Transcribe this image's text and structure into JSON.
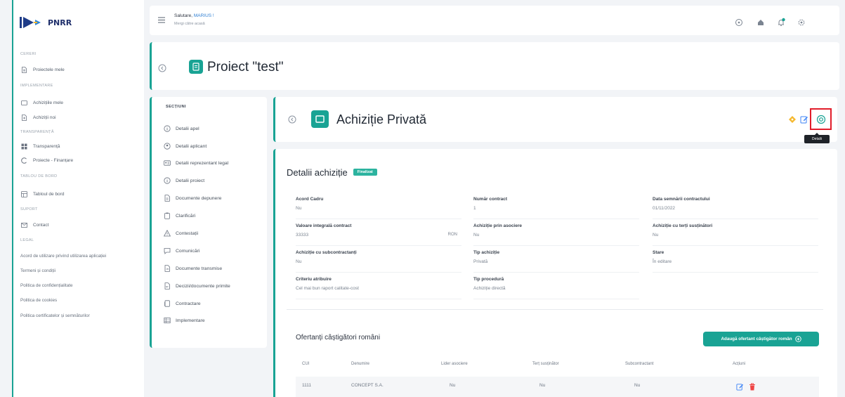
{
  "colors": {
    "accent": "#19a394",
    "badge": "#2cb39f",
    "highlight": "#e11d2a",
    "edit": "#3b82f6",
    "delete": "#ef4444",
    "pending": "#f5b82e"
  },
  "app": {
    "logo_text": "PNRR",
    "logo_icon": "pnrr-arrows-logo"
  },
  "topbar": {
    "menu_icon": "hamburger-icon",
    "greeting_prefix": "Salutare,",
    "user_name": "MARIUS !",
    "subtitle": "Mergi către acasă",
    "icons": [
      "help-icon",
      "home-icon",
      "notification-bell-icon",
      "settings-icon"
    ]
  },
  "sidebar": {
    "groups": [
      {
        "header": "CERERI",
        "items": [
          {
            "label": "Proiectele mele",
            "icon": "document-icon"
          }
        ]
      },
      {
        "header": "IMPLEMENTARE",
        "items": [
          {
            "label": "Achizițiile mele",
            "icon": "box-icon"
          },
          {
            "label": "Achiziții noi",
            "icon": "document-plus-icon"
          }
        ]
      },
      {
        "header": "TRANSPARENȚĂ",
        "items": [
          {
            "label": "Transparență",
            "icon": "grid-icon"
          },
          {
            "label": "Proiecte - Finanțare",
            "icon": "pie-chart-icon"
          }
        ]
      },
      {
        "header": "TABLOU DE BORD",
        "items": [
          {
            "label": "Tabloul de bord",
            "icon": "dashboard-icon"
          }
        ]
      },
      {
        "header": "SUPORT",
        "items": [
          {
            "label": "Contact",
            "icon": "mail-icon"
          }
        ]
      },
      {
        "header": "LEGAL",
        "links": [
          "Acord de utilizare privind utilizarea aplicației",
          "Termeni și condiții",
          "Politica de confidențialitate",
          "Politica de cookies",
          "Politica certificatelor și semnăturilor"
        ]
      }
    ]
  },
  "project": {
    "title": "Proiect \"test\"",
    "icon": "document-icon"
  },
  "sections_nav": {
    "header": "SECȚIUNI",
    "items": [
      {
        "label": "Detalii apel",
        "icon": "info-circle-icon"
      },
      {
        "label": "Detalii aplicant",
        "icon": "user-circle-icon"
      },
      {
        "label": "Detalii reprezentant legal",
        "icon": "id-card-icon"
      },
      {
        "label": "Detalii proiect",
        "icon": "info-circle-icon"
      },
      {
        "label": "Documente depunere",
        "icon": "document-icon"
      },
      {
        "label": "Clarificări",
        "icon": "clipboard-icon"
      },
      {
        "label": "Contestații",
        "icon": "warning-icon"
      },
      {
        "label": "Comunicări",
        "icon": "chat-icon"
      },
      {
        "label": "Documente transmise",
        "icon": "document-send-icon"
      },
      {
        "label": "Decizii/documente primite",
        "icon": "document-inbox-icon"
      },
      {
        "label": "Contractare",
        "icon": "contract-icon"
      },
      {
        "label": "Implementare",
        "icon": "table-icon"
      }
    ]
  },
  "acquisition": {
    "title": "Achiziție Privată",
    "icon": "card-icon",
    "actions": [
      "pending-diamond-icon",
      "edit-icon",
      "settings-icon"
    ],
    "tooltip": "Detalii",
    "details": {
      "heading": "Detalii achiziție",
      "badge": "Finalizat",
      "fields": [
        {
          "label": "Acord Cadru",
          "value": "Nu"
        },
        {
          "label": "Număr contract",
          "value": "1"
        },
        {
          "label": "Data semnării contractului",
          "value": "01/11/2022"
        },
        {
          "label": "Valoare integrală contract",
          "value": "33333",
          "unit": "RON"
        },
        {
          "label": "Achiziție prin asociere",
          "value": "Nu"
        },
        {
          "label": "Achiziție cu terți susținători",
          "value": "Nu"
        },
        {
          "label": "Achiziție cu subcontractanți",
          "value": "Nu"
        },
        {
          "label": "Tip achiziție",
          "value": "Privată"
        },
        {
          "label": "Stare",
          "value": "În editare"
        },
        {
          "label": "Criteriu atribuire",
          "value": "Cel mai bun raport calitate-cost"
        },
        {
          "label": "Tip procedură",
          "value": "Achiziție directă"
        }
      ]
    }
  },
  "winners": {
    "heading": "Ofertanți câștigători români",
    "add_button": "Adaugă ofertant câștigător român",
    "columns": [
      "CUI",
      "Denumire",
      "Lider asociere",
      "Terț susținător",
      "Subcontractant",
      "Acțiuni"
    ],
    "rows": [
      {
        "cui": "1111",
        "name": "CONCEPT S.A.",
        "lider": "Nu",
        "tert": "Nu",
        "sub": "Nu"
      }
    ]
  }
}
